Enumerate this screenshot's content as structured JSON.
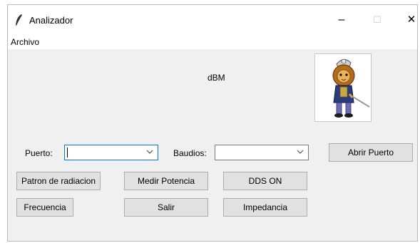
{
  "window": {
    "title": "Analizador",
    "minimize_glyph": "–",
    "maximize_glyph": "☐",
    "close_glyph": "✕"
  },
  "menu": {
    "items": [
      {
        "label": "Archivo"
      }
    ]
  },
  "main": {
    "dbm_label": "dBM",
    "puerto": {
      "label": "Puerto:",
      "value": ""
    },
    "baudios": {
      "label": "Baudios:",
      "value": ""
    },
    "buttons": {
      "abrir_puerto": "Abrir Puerto",
      "patron_radiacion": "Patron de radiacion",
      "medir_potencia": "Medir Potencia",
      "dds_on": "DDS ON",
      "frecuencia": "Frecuencia",
      "salir": "Salir",
      "impedancia": "Impedancia"
    },
    "image": {
      "subject": "cartoon lion knight with sword"
    }
  }
}
